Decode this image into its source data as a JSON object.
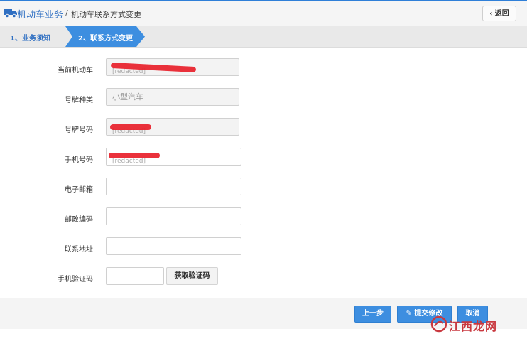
{
  "header": {
    "icon": "truck-icon",
    "breadcrumb_main": "机动车业务",
    "breadcrumb_sep": "/",
    "breadcrumb_sub": "机动车联系方式变更",
    "back_label": "返回",
    "accent": "#2f7fd8"
  },
  "steps": [
    {
      "label": "1、业务须知",
      "active": false
    },
    {
      "label": "2、联系方式变更",
      "active": true
    }
  ],
  "form": {
    "vehicle": {
      "label": "当前机动车",
      "value": "[redacted]"
    },
    "plate_type": {
      "label": "号牌种类",
      "value": "小型汽车"
    },
    "plate_number": {
      "label": "号牌号码",
      "value": "[redacted]"
    },
    "phone": {
      "label": "手机号码",
      "value": "[redacted]"
    },
    "email": {
      "label": "电子邮箱",
      "value": ""
    },
    "postcode": {
      "label": "邮政编码",
      "value": ""
    },
    "address": {
      "label": "联系地址",
      "value": ""
    },
    "sms_code": {
      "label": "手机验证码",
      "value": "",
      "button": "获取验证码"
    }
  },
  "footer": {
    "prev": "上一步",
    "submit": "提交修改",
    "cancel": "取消"
  },
  "watermark": {
    "text": "江西龙网",
    "color": "#c9383f"
  }
}
